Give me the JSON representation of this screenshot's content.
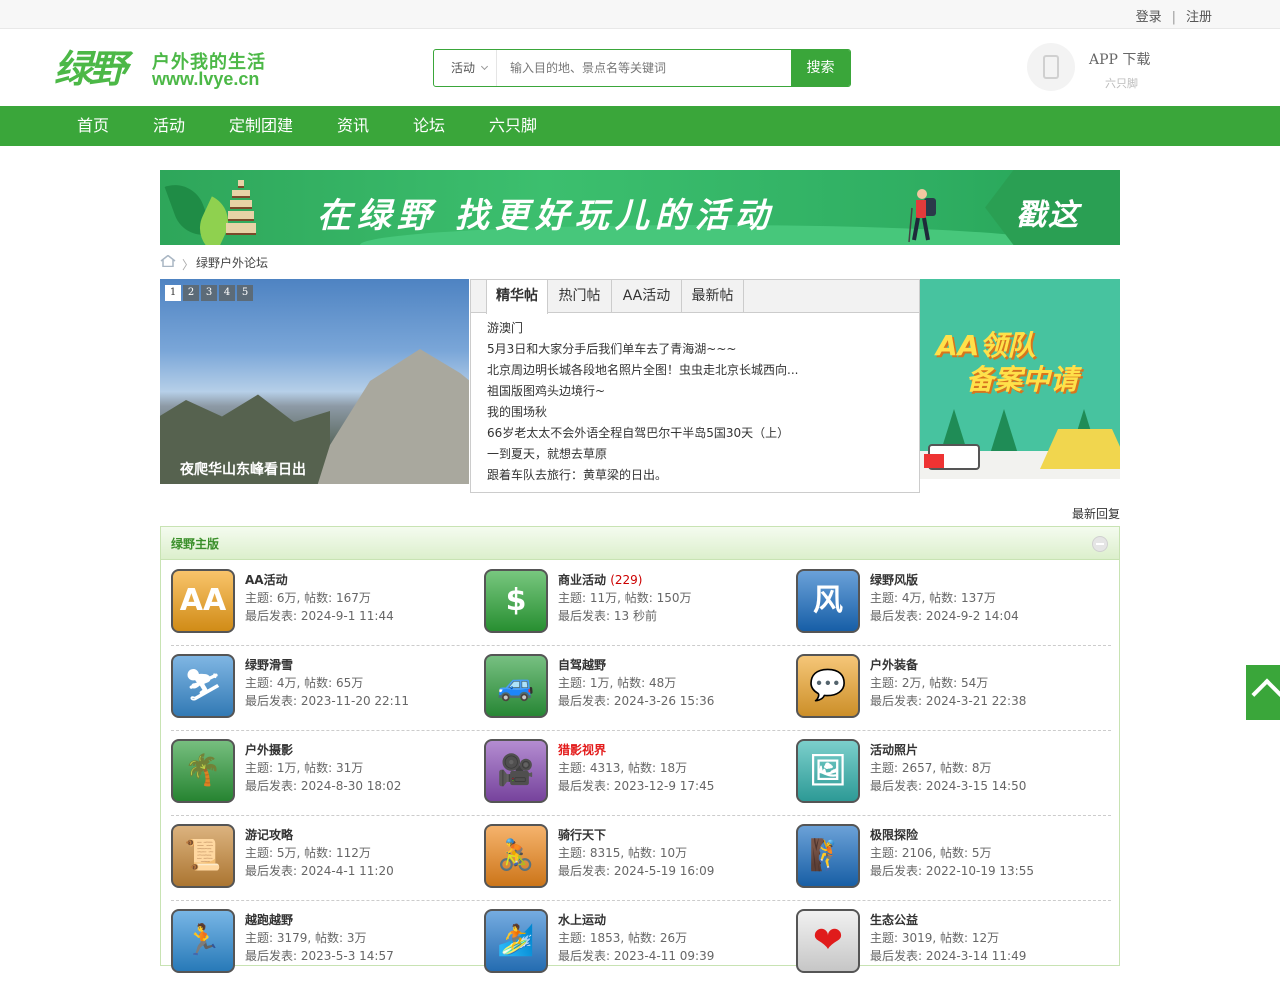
{
  "topbar": {
    "login": "登录",
    "separator": "|",
    "register": "注册"
  },
  "logo": {
    "mark": "绿野",
    "slogan": "户外我的生活",
    "url": "www.lvye.cn"
  },
  "search": {
    "category": "活动",
    "placeholder": "输入目的地、景点名等关键词",
    "button": "搜索"
  },
  "app": {
    "title": "APP 下载",
    "subtitle": "六只脚"
  },
  "nav": [
    "首页",
    "活动",
    "定制团建",
    "资讯",
    "论坛",
    "六只脚"
  ],
  "banner": {
    "text": "在绿野 找更好玩儿的活动",
    "cta": "戳这"
  },
  "breadcrumb": {
    "current": "绿野户外论坛"
  },
  "slider": {
    "pages": [
      "1",
      "2",
      "3",
      "4",
      "5"
    ],
    "caption": "夜爬华山东峰看日出"
  },
  "tabs": {
    "labels": [
      "精华帖",
      "热门帖",
      "AA活动",
      "最新帖"
    ],
    "items": [
      "游澳门",
      "5月3日和大家分手后我们单车去了青海湖~~~",
      "北京周边明长城各段地名照片全图！虫虫走北京长城西向...",
      "祖国版图鸡头边境行~",
      "我的围场秋",
      "66岁老太太不会外语全程自驾巴尔干半岛5国30天（上）",
      "一到夏天，就想去草原",
      "跟着车队去旅行：黄草梁的日出。"
    ]
  },
  "aa_ad": {
    "line1": "AA领队",
    "line2": "备案中请"
  },
  "latest_reply": "最新回复",
  "forum": {
    "title": "绿野主版",
    "rows": [
      [
        {
          "name": "AA活动",
          "count": "",
          "topics": "主题: 6万, 帖数: 167万",
          "last": "最后发表: 2024-9-1 11:44",
          "icon": "aa-icon",
          "sym": "AA",
          "color": "#f5a41b"
        },
        {
          "name": "商业活动",
          "count": "(229)",
          "topics": "主题: 11万, 帖数: 150万",
          "last": "最后发表: 13 秒前",
          "icon": "money-bag-icon",
          "sym": "$",
          "color": "#2fa83a"
        },
        {
          "name": "绿野风版",
          "count": "",
          "topics": "主题: 4万, 帖数: 137万",
          "last": "最后发表: 2024-9-2 14:04",
          "icon": "wind-icon",
          "sym": "风",
          "color": "#1b6fc4"
        }
      ],
      [
        {
          "name": "绿野滑雪",
          "count": "",
          "topics": "主题: 4万, 帖数: 65万",
          "last": "最后发表: 2023-11-20 22:11",
          "icon": "ski-icon",
          "sym": "⛷",
          "color": "#3b8fd4"
        },
        {
          "name": "自驾越野",
          "count": "",
          "topics": "主题: 1万, 帖数: 48万",
          "last": "最后发表: 2024-3-26 15:36",
          "icon": "car-icon",
          "sym": "🚙",
          "color": "#2e9e3e"
        },
        {
          "name": "户外装备",
          "count": "",
          "topics": "主题: 2万, 帖数: 54万",
          "last": "最后发表: 2024-3-21 22:38",
          "icon": "chat-bubble-icon",
          "sym": "💬",
          "color": "#f0a830"
        }
      ],
      [
        {
          "name": "户外摄影",
          "count": "",
          "topics": "主题: 1万, 帖数: 31万",
          "last": "最后发表: 2024-8-30 18:02",
          "icon": "palm-tree-icon",
          "sym": "🌴",
          "color": "#2d9b3a"
        },
        {
          "name": "猎影视界",
          "count": "",
          "topics": "主题: 4313, 帖数: 18万",
          "last": "最后发表: 2023-12-9 17:45",
          "icon": "film-camera-icon",
          "sym": "🎥",
          "color": "#8b4fb8",
          "highlight": true
        },
        {
          "name": "活动照片",
          "count": "",
          "topics": "主题: 2657, 帖数: 8万",
          "last": "最后发表: 2024-3-15 14:50",
          "icon": "photo-icon",
          "sym": "🖼",
          "color": "#35b5b0"
        }
      ],
      [
        {
          "name": "游记攻略",
          "count": "",
          "topics": "主题: 5万, 帖数: 112万",
          "last": "最后发表: 2024-4-1 11:20",
          "icon": "map-scroll-icon",
          "sym": "📜",
          "color": "#c98a3a"
        },
        {
          "name": "骑行天下",
          "count": "",
          "topics": "主题: 8315, 帖数: 10万",
          "last": "最后发表: 2024-5-19 16:09",
          "icon": "bicycle-icon",
          "sym": "🚴",
          "color": "#f08a1e"
        },
        {
          "name": "极限探险",
          "count": "",
          "topics": "主题: 2106, 帖数: 5万",
          "last": "最后发表: 2022-10-19 13:55",
          "icon": "climber-icon",
          "sym": "🧗",
          "color": "#1c6fc2"
        }
      ],
      [
        {
          "name": "越跑越野",
          "count": "",
          "topics": "主题: 3179, 帖数: 3万",
          "last": "最后发表: 2023-5-3 14:57",
          "icon": "runner-icon",
          "sym": "🏃",
          "color": "#2f8fd8"
        },
        {
          "name": "水上运动",
          "count": "",
          "topics": "主题: 1853, 帖数: 26万",
          "last": "最后发表: 2023-4-11 09:39",
          "icon": "surf-icon",
          "sym": "🏄",
          "color": "#2b7fd0"
        },
        {
          "name": "生态公益",
          "count": "",
          "topics": "主题: 3019, 帖数: 12万",
          "last": "最后发表: 2024-3-14 11:49",
          "icon": "heart-icon",
          "sym": "❤",
          "color": "#e9e9e9"
        }
      ]
    ]
  }
}
